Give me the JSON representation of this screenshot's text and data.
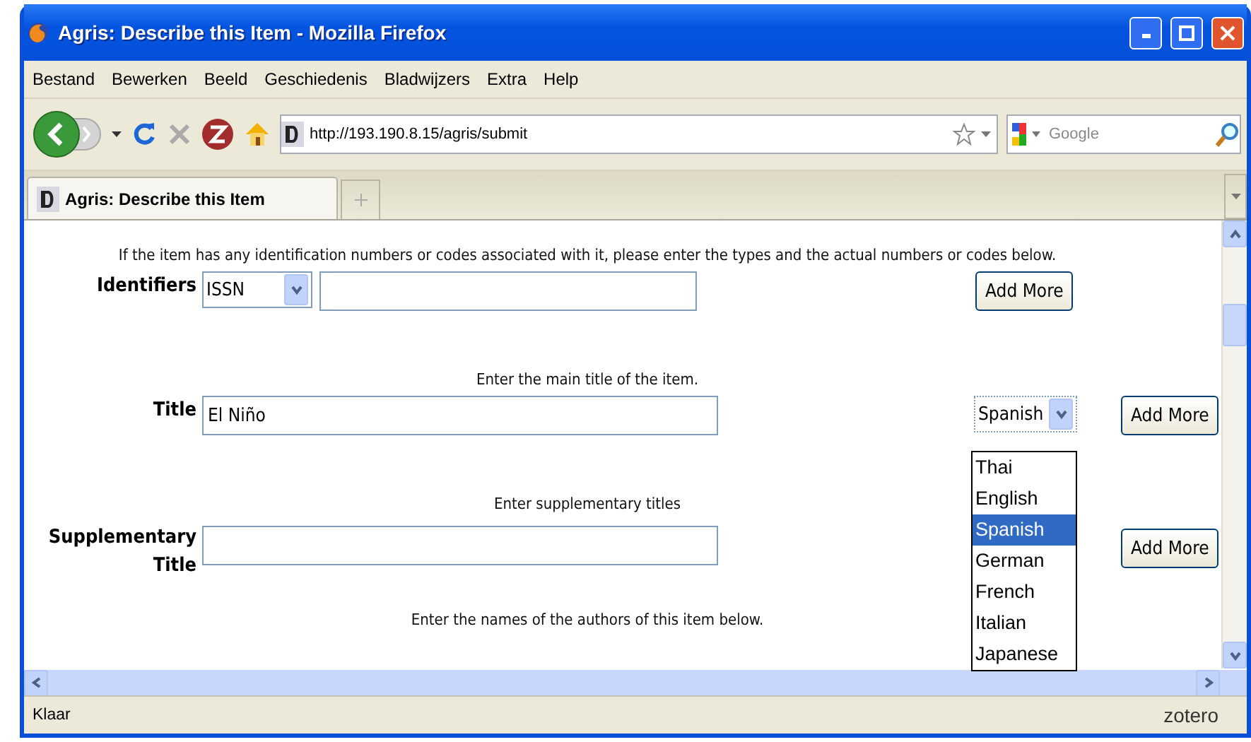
{
  "window": {
    "title": "Agris: Describe this Item - Mozilla Firefox"
  },
  "menu": [
    {
      "label": "Bestand"
    },
    {
      "label": "Bewerken"
    },
    {
      "label": "Beeld"
    },
    {
      "label": "Geschiedenis"
    },
    {
      "label": "Bladwijzers"
    },
    {
      "label": "Extra"
    },
    {
      "label": "Help"
    }
  ],
  "address_bar": {
    "value": "http://193.190.8.15/agris/submit"
  },
  "search": {
    "placeholder": "Google"
  },
  "tabs": [
    {
      "label": "Agris: Describe this Item",
      "selected": true
    }
  ],
  "form": {
    "sections": [
      {
        "kind": "identifier",
        "hint": "If the item has any identification numbers or codes associated with it, please enter the types and the actual numbers or codes below.",
        "label": "Identifiers",
        "type_select": "ISSN",
        "button": "Add More"
      },
      {
        "kind": "title",
        "hint": "Enter the main title of the item.",
        "label": "Title",
        "value": "El Niño",
        "language": "Spanish",
        "expanded": true,
        "options": [
          {
            "label": "Thai",
            "selected": false
          },
          {
            "label": "English",
            "selected": false
          },
          {
            "label": "Spanish",
            "selected": true
          },
          {
            "label": "German",
            "selected": false
          },
          {
            "label": "French",
            "selected": false
          },
          {
            "label": "Italian",
            "selected": false
          },
          {
            "label": "Japanese",
            "selected": false
          }
        ],
        "button": "Add More"
      },
      {
        "kind": "supplementary",
        "hint": "Enter supplementary titles",
        "label_lines": [
          "Supplementary",
          "Title"
        ],
        "button": "Add More"
      },
      {
        "kind": "hint",
        "hint": "Enter the names of the authors of this item below."
      }
    ]
  },
  "status_bar": {
    "text": "Klaar",
    "addon": "zotero"
  }
}
